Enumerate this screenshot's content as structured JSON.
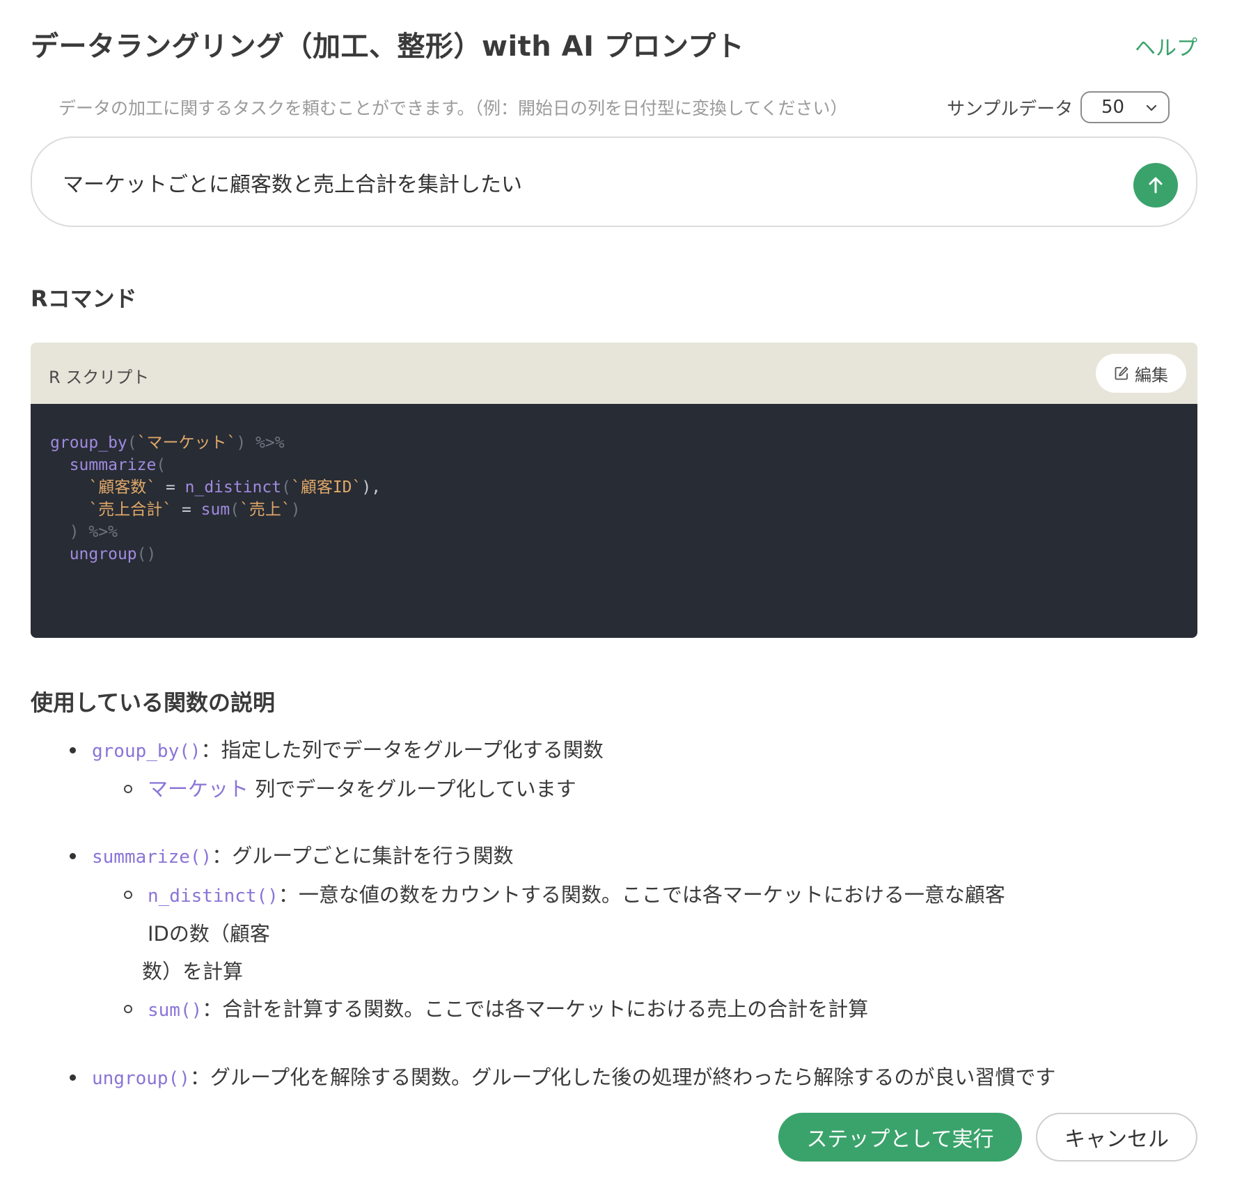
{
  "dialog": {
    "title": "データラングリング（加工、整形）with AI プロンプト",
    "help_label": "ヘルプ"
  },
  "prompt": {
    "hint": "データの加工に関するタスクを頼むことができます。（例：開始日の列を日付型に変換してください）",
    "sample_label": "サンプルデータ",
    "sample_value": "50",
    "input_text": "マーケットごとに顧客数と売上合計を集計したい",
    "send_icon": "arrow-up-icon"
  },
  "r_command": {
    "section_title": "Rコマンド",
    "panel_label": "R スクリプト",
    "edit_label": "編集",
    "edit_icon": "edit-icon",
    "code": {
      "l1_fn": "group_by",
      "l1_p1": "(",
      "l1_s1": "`マーケット`",
      "l1_p2": ")",
      "l1_pipe": " %>%",
      "l2_indent": "  ",
      "l2_fn": "summarize",
      "l2_p1": "(",
      "l3_indent": "    ",
      "l3_s1": "`顧客数`",
      "l3_op": " = ",
      "l3_fn": "n_distinct",
      "l3_p1": "(",
      "l3_s2": "`顧客ID`",
      "l3_p2": "),",
      "l4_indent": "    ",
      "l4_s1": "`売上合計`",
      "l4_op": " = ",
      "l4_fn": "sum",
      "l4_p1": "(",
      "l4_s2": "`売上`",
      "l4_p2": ")",
      "l5_indent": "  ",
      "l5_p1": ")",
      "l5_pipe": " %>%",
      "l6_indent": "  ",
      "l6_fn": "ungroup",
      "l6_p1": "()"
    }
  },
  "explanation": {
    "section_title": "使用している関数の説明",
    "items": [
      {
        "code": "group_by()",
        "text": "：指定した列でデータをグループ化する関数",
        "subs": [
          {
            "code": "マーケット",
            "text": " 列でデータをグループ化しています"
          }
        ]
      },
      {
        "code": "summarize()",
        "text": "：グループごとに集計を行う関数",
        "subs": [
          {
            "code": "n_distinct()",
            "text": "：一意な値の数をカウントする関数。ここでは各マーケットにおける一意な顧客IDの数（顧客",
            "text_cont": "数）を計算"
          },
          {
            "code": "sum()",
            "text": "：合計を計算する関数。ここでは各マーケットにおける売上の合計を計算"
          }
        ]
      },
      {
        "code": "ungroup()",
        "text": "：グループ化を解除する関数。グループ化した後の処理が終わったら解除するのが良い習慣です"
      }
    ]
  },
  "footer": {
    "run_label": "ステップとして実行",
    "cancel_label": "キャンセル"
  },
  "colors": {
    "accent": "#3aa36b",
    "code_bg": "#282c34",
    "code_header_bg": "#e7e5da",
    "code_function": "#a08be0",
    "code_string": "#e0a86a"
  }
}
